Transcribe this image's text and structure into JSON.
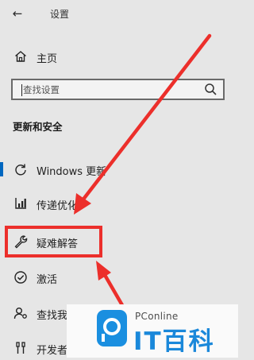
{
  "header": {
    "title": "设置",
    "back_icon": "back-arrow-icon"
  },
  "home": {
    "label": "主页",
    "icon": "home-icon"
  },
  "search": {
    "placeholder": "查找设置",
    "icon": "search-icon"
  },
  "section": {
    "heading": "更新和安全"
  },
  "nav_items": [
    {
      "label": "Windows 更新",
      "icon": "sync-icon",
      "selected": true
    },
    {
      "label": "传递优化",
      "icon": "delivery-optimization-icon"
    },
    {
      "label": "疑难解答",
      "icon": "wrench-icon"
    },
    {
      "label": "激活",
      "icon": "checkmark-circle-icon"
    },
    {
      "label": "查找我的设备",
      "icon": "person-locate-icon"
    },
    {
      "label": "开发者选项",
      "icon": "developer-icon"
    }
  ],
  "annotation": {
    "color": "#ec2f2b",
    "highlighted_item": "疑难解答"
  },
  "watermark": {
    "brand": "PConline",
    "name": "IT百科",
    "color": "#1a88da"
  },
  "colors": {
    "accent": "#0067c0",
    "background": "#e6e6e6"
  }
}
